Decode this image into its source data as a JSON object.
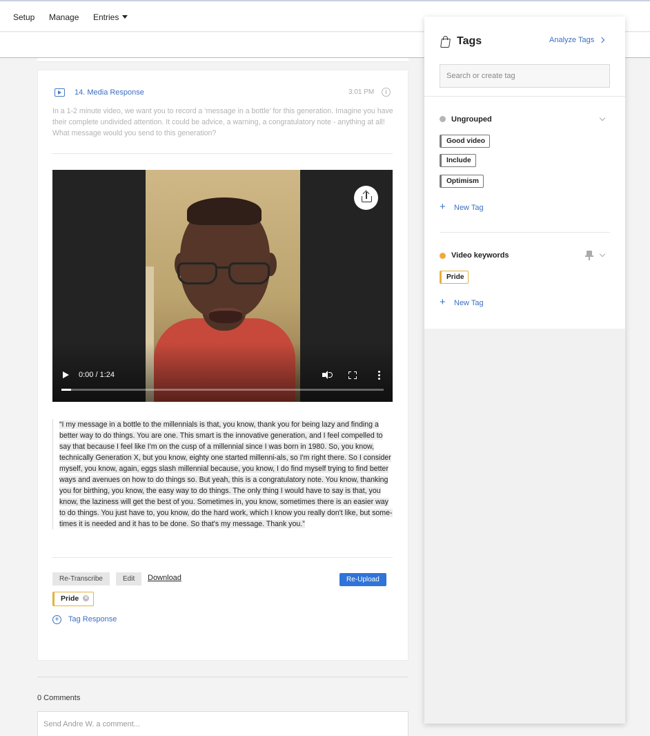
{
  "nav": {
    "items": [
      "Setup",
      "Manage"
    ],
    "entries_label": "Entries"
  },
  "question": {
    "title": "14. Media Response",
    "time": "3:01 PM",
    "description": "In a 1-2 minute video, we want you to record a ‘message in a bottle’ for this generation. Imagine you have their complete undivided attention. It could be advice, a warning, a congratulatory note - anything at all! What message would you send to this generation?"
  },
  "video": {
    "time_display": "0:00 / 1:24",
    "progress": 0.03
  },
  "transcript": "“I my message in a bottle to the millennials is that, you know, thank you for being lazy and finding a better way to do things. You are one. This smart is the innovative generation, and I feel compelled to say that because I feel like I'm on the cusp of a millennial since I was born in 1980. So, you know, technically Generation X, but you know, eighty one started millenni-als, so I'm right there. So I consider myself, you know, again, eggs slash millennial because, you know, I do find myself trying to find better ways and avenues on how to do things so. But yeah, this is a congratulatory note. You know, thanking you for birthing, you know, the easy way to do things. The only thing I would have to say is that, you know, the laziness will get the best of you. Sometimes in, you know, sometimes there is an easier way to do things. You just have to, you know, do the hard work, which I know you really don't like, but some-times it is needed and it has to be done. So that's my message. Thank you.”",
  "actions": {
    "retranscribe": "Re-Transcribe",
    "edit": "Edit",
    "download": "Download",
    "reupload": "Re-Upload"
  },
  "response_tag": "Pride",
  "tag_response_label": "Tag Response",
  "comments": {
    "count_label": "0 Comments",
    "placeholder": "Send Andre W. a comment..."
  },
  "tags_panel": {
    "title": "Tags",
    "analyze_label": "Analyze Tags",
    "search_placeholder": "Search or create tag",
    "new_tag_label": "New Tag",
    "groups": [
      {
        "name": "Ungrouped",
        "color": "#b5b5b5",
        "tags": [
          "Good video",
          "Include",
          "Optimism"
        ]
      },
      {
        "name": "Video keywords",
        "color": "#f0a93b",
        "tags": [
          "Pride"
        ]
      }
    ]
  },
  "colors": {
    "accent_blue": "#2f74d8",
    "link_blue": "#3b6fc1",
    "tag_gold": "#e6b13b"
  }
}
